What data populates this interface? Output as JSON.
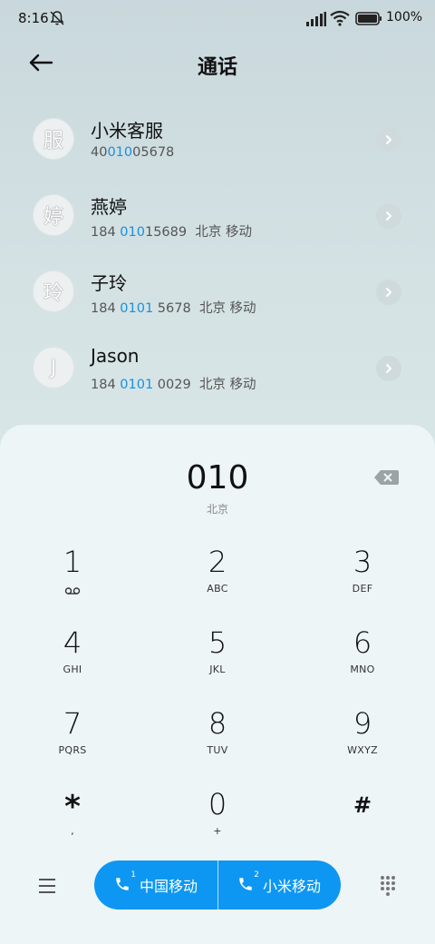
{
  "status": {
    "time": "8:16",
    "battery": "100%"
  },
  "header": {
    "title": "通话"
  },
  "contacts": [
    {
      "avatar": "服",
      "name": "小米客服",
      "num_pre": "40",
      "num_hl": "010",
      "num_post": "05678",
      "location": ""
    },
    {
      "avatar": "婷",
      "name": "燕婷",
      "num_pre": "184 ",
      "num_hl": "010",
      "num_post": "15689",
      "location": "北京 移动"
    },
    {
      "avatar": "玲",
      "name": "子玲",
      "num_pre": "184 ",
      "num_hl": "0101",
      "num_post": " 5678",
      "location": "北京 移动"
    },
    {
      "avatar": "J",
      "name": "Jason",
      "num_pre": "184 ",
      "num_hl": "0101",
      "num_post": " 0029",
      "location": "北京 移动"
    }
  ],
  "dial": {
    "input": "010",
    "location": "北京"
  },
  "keys": [
    {
      "digit": "1",
      "sub": "voicemail"
    },
    {
      "digit": "2",
      "sub": "ABC"
    },
    {
      "digit": "3",
      "sub": "DEF"
    },
    {
      "digit": "4",
      "sub": "GHI"
    },
    {
      "digit": "5",
      "sub": "JKL"
    },
    {
      "digit": "6",
      "sub": "MNO"
    },
    {
      "digit": "7",
      "sub": "PQRS"
    },
    {
      "digit": "8",
      "sub": "TUV"
    },
    {
      "digit": "9",
      "sub": "WXYZ"
    },
    {
      "digit": "*",
      "sub": ","
    },
    {
      "digit": "0",
      "sub": "+"
    },
    {
      "digit": "#",
      "sub": ""
    }
  ],
  "call_buttons": [
    {
      "sim": "1",
      "label": "中国移动"
    },
    {
      "sim": "2",
      "label": "小米移动"
    }
  ],
  "colors": {
    "accent": "#0d97f2",
    "highlight": "#1a8fe0",
    "panel": "#eef5f6"
  }
}
